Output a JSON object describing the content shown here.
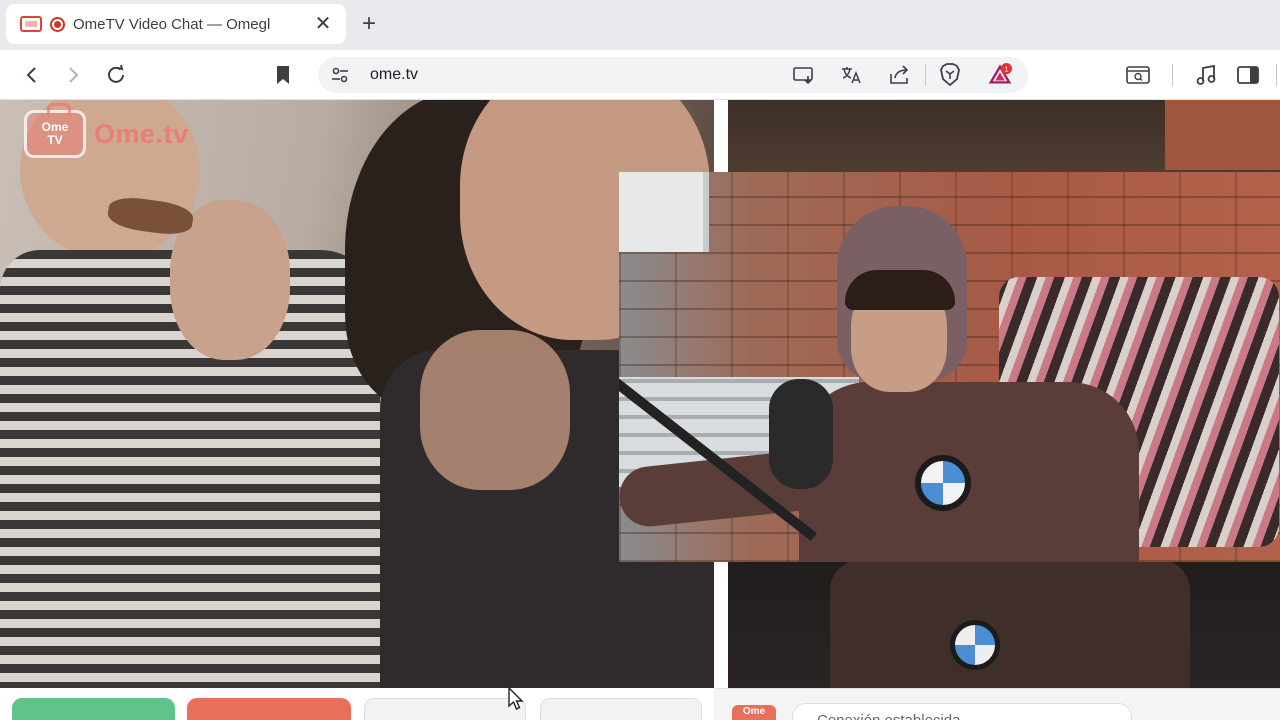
{
  "browser": {
    "tab": {
      "title": "OmeTV Video Chat — Omegl",
      "close_glyph": "✕"
    },
    "new_tab_glyph": "+",
    "address": {
      "url": "ome.tv"
    },
    "badge_count": "1",
    "icons": [
      "back-icon",
      "forward-icon",
      "reload-icon",
      "bookmark-icon",
      "site-settings-icon",
      "install-app-icon",
      "translate-icon",
      "share-icon",
      "brave-shield-icon",
      "brave-rewards-icon",
      "tab-search-icon",
      "media-icon",
      "sidebar-icon"
    ]
  },
  "page": {
    "logo": {
      "tv_line1": "Ome",
      "tv_line2": "TV",
      "text": "Ome.tv"
    },
    "chat": {
      "logo_text": "Ome",
      "message": "Conexión establecida"
    },
    "colors": {
      "start": "#5fc38a",
      "stop": "#e86f5a",
      "brand": "#e86f5a"
    }
  }
}
